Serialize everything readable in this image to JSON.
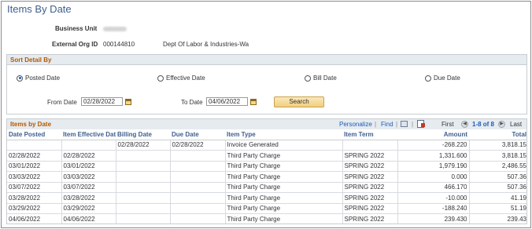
{
  "page": {
    "title": "Items By Date"
  },
  "header": {
    "business_unit_label": "Business Unit",
    "external_org_label": "External Org ID",
    "external_org_id": "000144810",
    "external_org_name": "Dept Of Labor & Industries-Wa"
  },
  "sort": {
    "header": "Sort Detail By",
    "options": [
      {
        "label": "Posted Date",
        "checked": true
      },
      {
        "label": "Effective Date",
        "checked": false
      },
      {
        "label": "Bill Date",
        "checked": false
      },
      {
        "label": "Due Date",
        "checked": false
      }
    ],
    "from_label": "From Date",
    "from_value": "02/28/2022",
    "to_label": "To Date",
    "to_value": "04/06/2022",
    "search_label": "Search"
  },
  "grid": {
    "title": "Items by Date",
    "personalize": "Personalize",
    "find": "Find",
    "sep": "|",
    "first": "First",
    "range": "1-8 of 8",
    "last": "Last",
    "prev_glyph": "◀",
    "next_glyph": "▶",
    "columns": [
      "Date Posted",
      "Item Effective Date",
      "Billing Date",
      "Due Date",
      "Item Type",
      "Item Term",
      "Amount",
      "Total"
    ],
    "rows": [
      [
        "",
        "",
        "02/28/2022",
        "02/28/2022",
        "Invoice Generated",
        "",
        "-268.220",
        "3,818.15"
      ],
      [
        "02/28/2022",
        "02/28/2022",
        "",
        "",
        "Third Party Charge",
        "SPRING 2022",
        "1,331.600",
        "3,818.15"
      ],
      [
        "03/01/2022",
        "03/01/2022",
        "",
        "",
        "Third Party Charge",
        "SPRING 2022",
        "1,979.190",
        "2,486.55"
      ],
      [
        "03/03/2022",
        "03/03/2022",
        "",
        "",
        "Third Party Charge",
        "SPRING 2022",
        "0.000",
        "507.36"
      ],
      [
        "03/07/2022",
        "03/07/2022",
        "",
        "",
        "Third Party Charge",
        "SPRING 2022",
        "466.170",
        "507.36"
      ],
      [
        "03/28/2022",
        "03/28/2022",
        "",
        "",
        "Third Party Charge",
        "SPRING 2022",
        "-10.000",
        "41.19"
      ],
      [
        "03/29/2022",
        "03/29/2022",
        "",
        "",
        "Third Party Charge",
        "SPRING 2022",
        "-188.240",
        "51.19"
      ],
      [
        "04/06/2022",
        "04/06/2022",
        "",
        "",
        "Third Party Charge",
        "SPRING 2022",
        "239.430",
        "239.43"
      ]
    ]
  },
  "colors": {
    "accent": "#3f5f8e",
    "section_header": "#b35900",
    "link": "#1d5cb5"
  },
  "icons": [
    "calendar-icon",
    "view-all-icon",
    "download-excel-icon",
    "previous-icon",
    "next-icon"
  ]
}
